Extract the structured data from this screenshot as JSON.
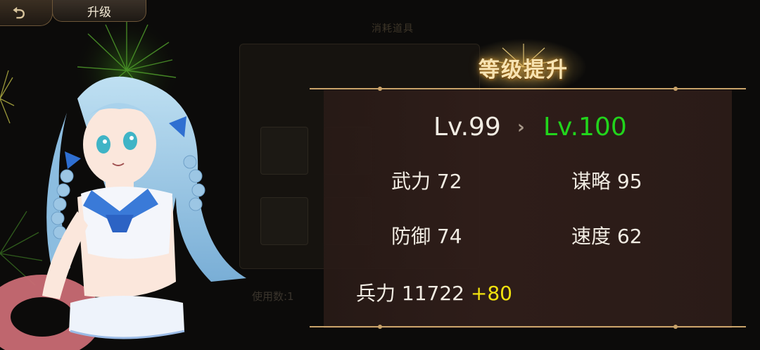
{
  "header": {
    "title": "升级"
  },
  "background_panel": {
    "title": "消耗道具",
    "use_count_label": "使用数:1"
  },
  "levelup": {
    "banner": "等级提升",
    "level_from": "Lv.99",
    "level_arrow": "›",
    "level_to": "Lv.100",
    "stats": [
      {
        "label": "武力",
        "value": "72"
      },
      {
        "label": "谋略",
        "value": "95"
      },
      {
        "label": "防御",
        "value": "74"
      },
      {
        "label": "速度",
        "value": "62"
      }
    ],
    "troops": {
      "label": "兵力",
      "value": "11722",
      "bonus": "+80"
    }
  },
  "colors": {
    "new_level": "#22d41c",
    "bonus": "#f2e20e",
    "text": "#f1ece3",
    "gold_border": "#c9a36a"
  }
}
